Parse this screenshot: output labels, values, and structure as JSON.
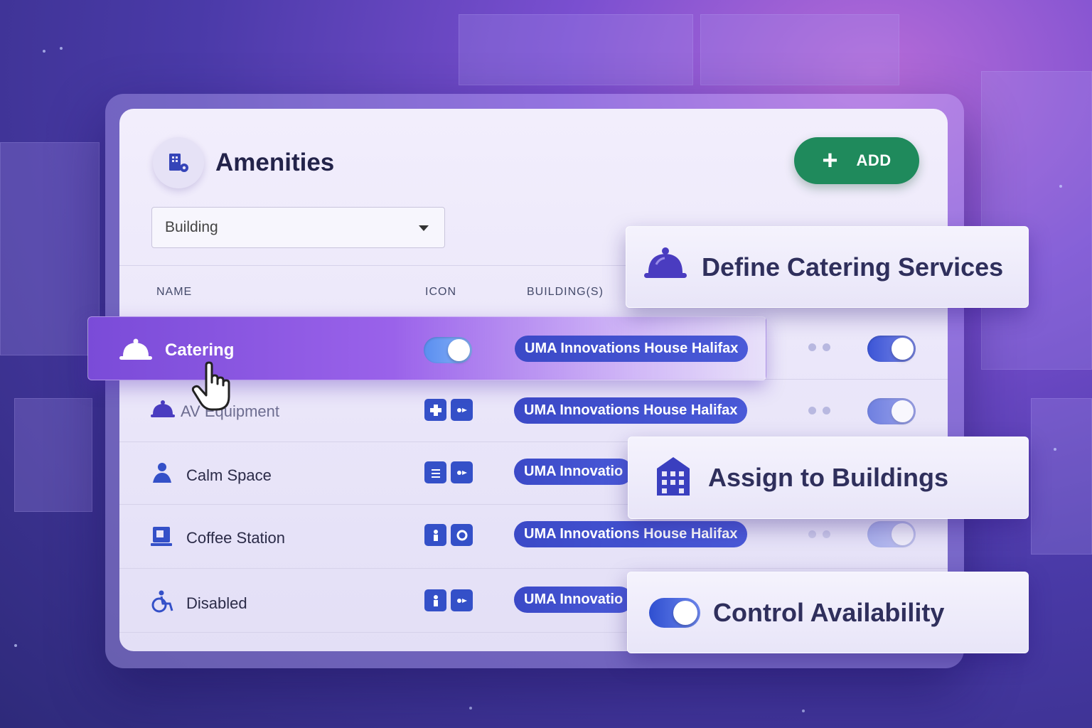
{
  "page": {
    "title": "Amenities",
    "add_button": "ADD",
    "filter": {
      "value": "Building"
    }
  },
  "columns": [
    "NAME",
    "ICON",
    "BUILDING(S)"
  ],
  "rows": [
    {
      "name": "Catering",
      "icon": "bell-icon",
      "building": "UMA Innovations House Halifax",
      "icon_enabled": true,
      "active": true
    },
    {
      "name": "AV Equipment",
      "icon": "bell-icon",
      "building": "UMA Innovations House Halifax",
      "active": true
    },
    {
      "name": "Calm Space",
      "icon": "person-meditate-icon",
      "building": "UMA Innovatio",
      "active": true
    },
    {
      "name": "Coffee Station",
      "icon": "coffee-icon",
      "building": "UMA Innovations House Halifax",
      "active": true
    },
    {
      "name": "Disabled",
      "icon": "wheelchair-icon",
      "building": "UMA Innovatio",
      "active": true
    }
  ],
  "callouts": [
    {
      "text": "Define Catering Services",
      "icon": "bell-icon"
    },
    {
      "text": "Assign to Buildings",
      "icon": "building-icon"
    },
    {
      "text": "Control Availability",
      "icon": "toggle-icon"
    }
  ],
  "colors": {
    "accent": "#7a4bd8",
    "add_button": "#1f8a5c",
    "pill": "#3b49c7",
    "title": "#23234a"
  }
}
